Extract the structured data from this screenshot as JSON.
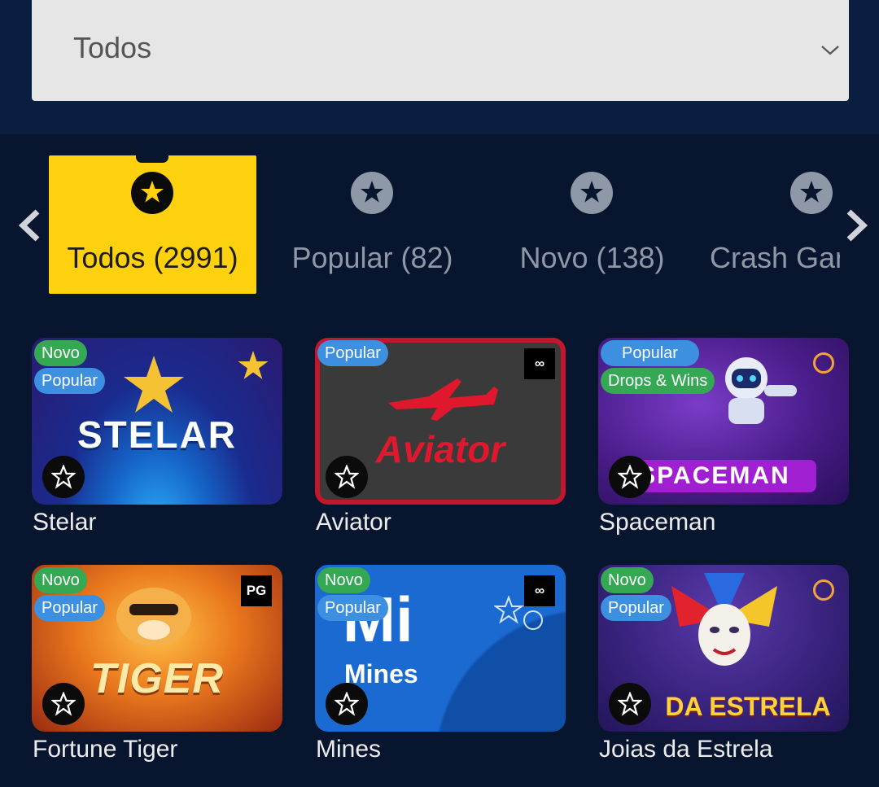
{
  "filter": {
    "selected": "Todos",
    "chevron_icon": "chevron-down-icon"
  },
  "categories": [
    {
      "label": "Todos (2991)",
      "icon": "star-icon",
      "active": true
    },
    {
      "label": "Popular (82)",
      "icon": "star-icon",
      "active": false
    },
    {
      "label": "Novo (138)",
      "icon": "star-icon",
      "active": false
    },
    {
      "label": "Crash Gam",
      "icon": "star-icon",
      "active": false
    }
  ],
  "nav": {
    "prev_icon": "chevron-left-icon",
    "next_icon": "chevron-right-icon"
  },
  "games": [
    {
      "name": "Stelar",
      "thumb_title": "STELAR",
      "badges": [
        "Novo",
        "Popular"
      ]
    },
    {
      "name": "Aviator",
      "thumb_title": "Aviator",
      "badges": [
        "Popular"
      ]
    },
    {
      "name": "Spaceman",
      "thumb_title": "SPACEMAN",
      "badges": [
        "Popular",
        "Drops & Wins"
      ]
    },
    {
      "name": "Fortune Tiger",
      "thumb_title": "TIGER",
      "badges": [
        "Novo",
        "Popular"
      ],
      "provider": "PG"
    },
    {
      "name": "Mines",
      "thumb_title": "Mines",
      "badges": [
        "Novo",
        "Popular"
      ]
    },
    {
      "name": "Joias da Estrela",
      "thumb_title": "DA ESTRELA",
      "badges": [
        "Novo",
        "Popular"
      ]
    }
  ],
  "colors": {
    "background": "#07152e",
    "active_category": "#fdd10d",
    "badge_novo": "#34a853",
    "badge_popular": "#3d8fe0"
  }
}
